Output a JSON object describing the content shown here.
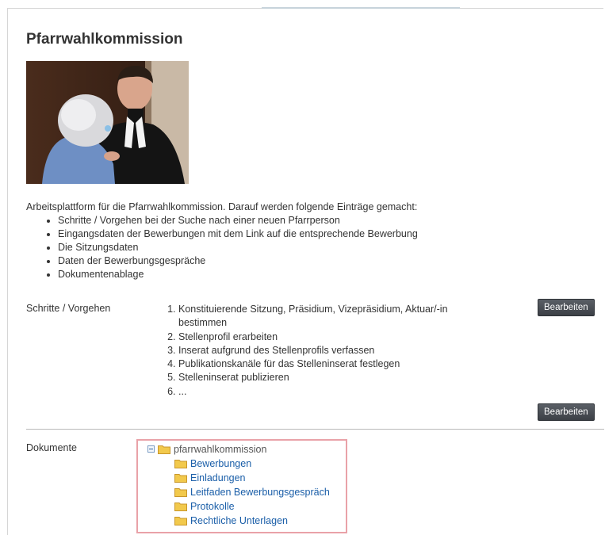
{
  "page": {
    "title": "Pfarrwahlkommission",
    "intro": "Arbeitsplattform für die Pfarrwahlkommission. Darauf werden folgende Einträge gemacht:",
    "bullets": [
      "Schritte / Vorgehen bei der Suche nach einer neuen Pfarrperson",
      "Eingangsdaten der Bewerbungen mit dem Link auf die entsprechende Bewerbung",
      "Die Sitzungsdaten",
      "Daten der Bewerbungsgespräche",
      "Dokumentenablage"
    ]
  },
  "steps_section": {
    "label": "Schritte / Vorgehen",
    "items": [
      "Konstituierende Sitzung, Präsidium, Vizepräsidium, Aktuar/-in bestimmen",
      "Stellenprofil erarbeiten",
      "Inserat aufgrund des Stellenprofils verfassen",
      "Publikationskanäle für das Stelleninserat festlegen",
      "Stelleninserat publizieren",
      "..."
    ],
    "edit_label_top": "Bearbeiten",
    "edit_label_bottom": "Bearbeiten"
  },
  "documents_section": {
    "label": "Dokumente",
    "root": "pfarrwahlkommission",
    "folders": [
      "Bewerbungen",
      "Einladungen",
      "Leitfaden Bewerbungsgespräch",
      "Protokolle",
      "Rechtliche Unterlagen"
    ]
  },
  "colors": {
    "link": "#1a5ea8",
    "button": "#4a4f55",
    "highlight_border": "#e9a2a8",
    "folder": "#f2c94c"
  },
  "icons": {
    "collapse": "minus-box-icon",
    "folder": "folder-icon"
  }
}
